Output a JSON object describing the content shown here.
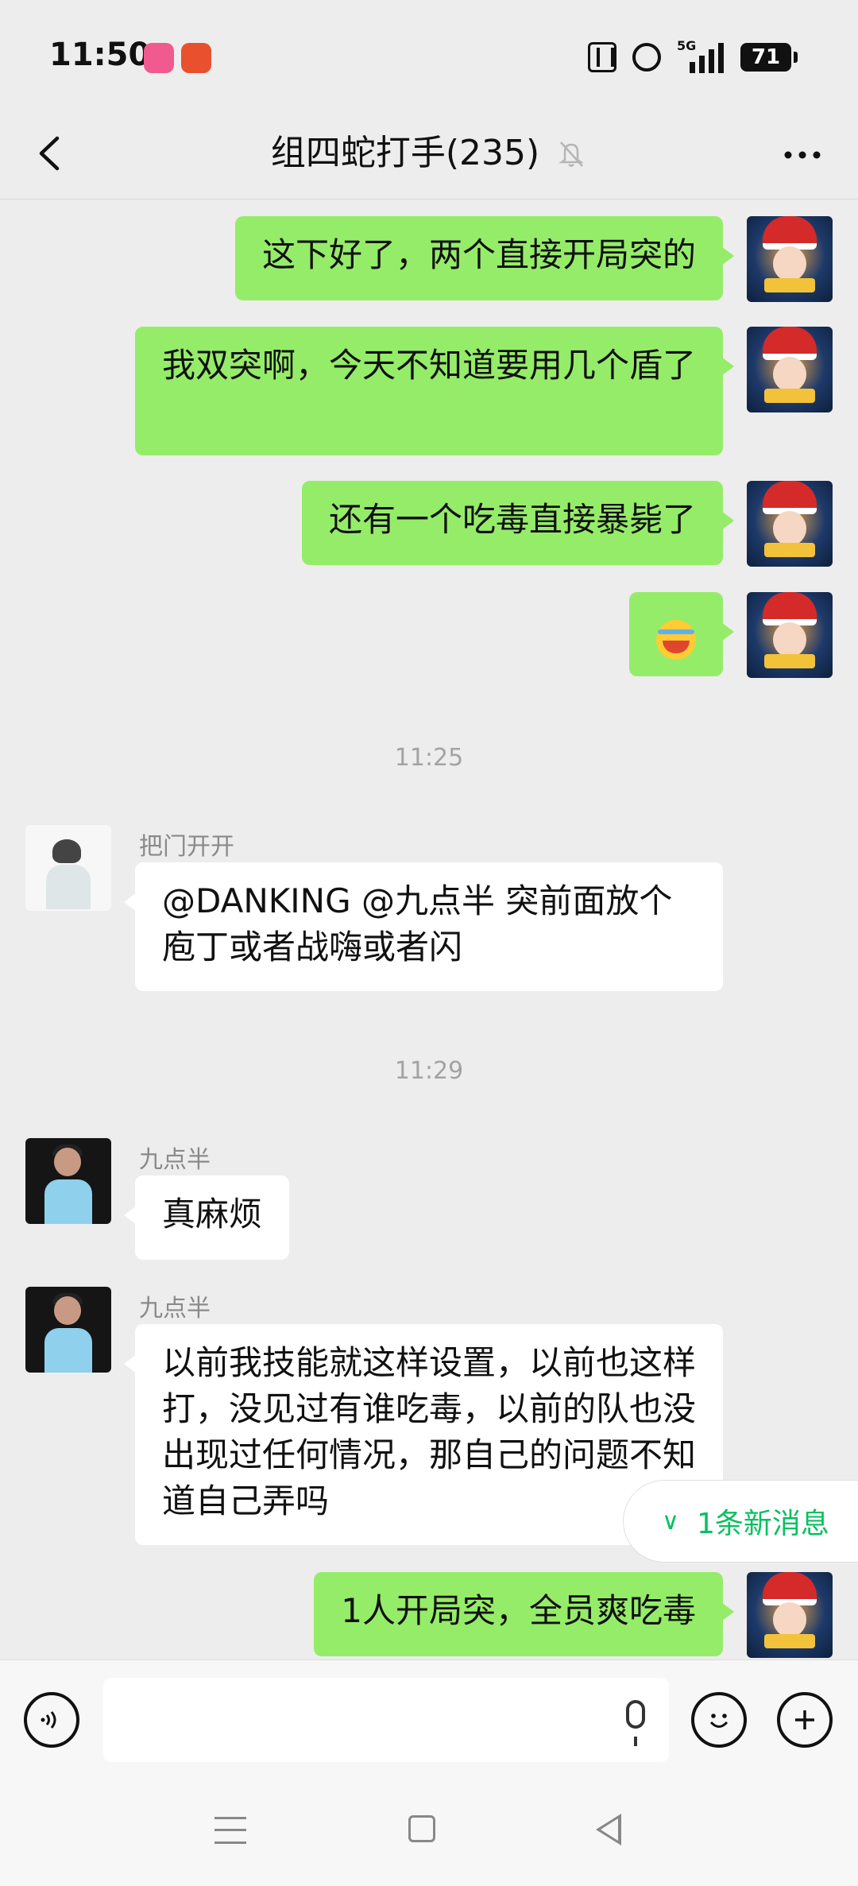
{
  "status_bar": {
    "time": "11:50",
    "battery": "71",
    "network": "5G",
    "app_icons": [
      "bilibili-icon",
      "app-icon"
    ]
  },
  "header": {
    "title": "组四蛇打手(235)",
    "back_icon": "chevron-left-icon",
    "mute_icon": "bell-off-icon",
    "more_icon": "more-dots-icon"
  },
  "messages": [
    {
      "from": "me",
      "text": "这下好了，两个直接开局突的"
    },
    {
      "from": "me",
      "text": "我双突啊，今天不知道要用几个盾了"
    },
    {
      "from": "me",
      "text": "还有一个吃毒直接暴毙了"
    },
    {
      "from": "me",
      "emoji": "crying-laughing-emoji"
    },
    {
      "timestamp": "11:25"
    },
    {
      "from": "other",
      "sender": "把门开开",
      "text": "@DANKING @九点半  突前面放个庖丁或者战嗨或者闪"
    },
    {
      "timestamp": "11:29"
    },
    {
      "from": "other",
      "sender": "九点半",
      "text": "真麻烦"
    },
    {
      "from": "other",
      "sender": "九点半",
      "text": "以前我技能就这样设置，以前也这样打，没见过有谁吃毒，以前的队也没出现过任何情况，那自己的问题不知道自己弄吗"
    },
    {
      "from": "me",
      "text": "1人开局突，全员爽吃毒"
    }
  ],
  "new_messages_badge": "1条新消息",
  "input_bar": {
    "voice_icon": "voice-icon",
    "mic_icon": "mic-icon",
    "emoji_icon": "emoji-icon",
    "plus_icon": "plus-icon"
  },
  "nav_bar": {
    "menu_icon": "menu-icon",
    "home_icon": "home-icon",
    "back_icon": "back-icon"
  },
  "colors": {
    "my_bubble": "#95ec69",
    "other_bubble": "#ffffff",
    "background": "#ededed",
    "accent": "#07c160"
  }
}
